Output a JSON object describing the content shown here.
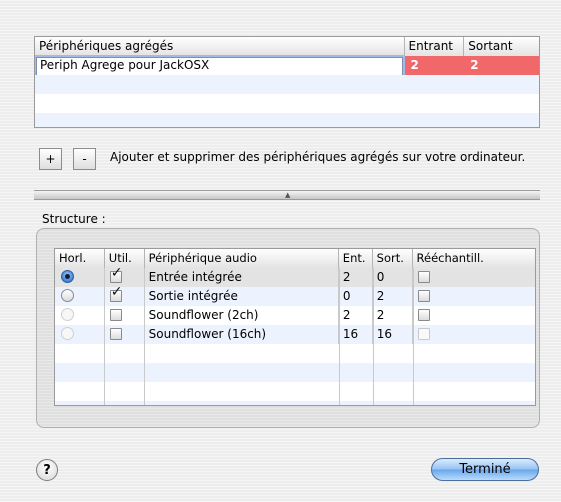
{
  "aggregate_table": {
    "columns": [
      "Périphériques agrégés",
      "Entrant",
      "Sortant"
    ],
    "rows": [
      {
        "name": "Periph Agrege pour JackOSX",
        "inputs": "2",
        "outputs": "2"
      }
    ],
    "selected_color": "#f0686a"
  },
  "buttons": {
    "add": "+",
    "remove": "-",
    "help": "?",
    "done": "Terminé"
  },
  "description": "Ajouter et supprimer des périphériques agrégés sur votre ordinateur.",
  "structure": {
    "label": "Structure :",
    "columns": [
      "Horl.",
      "Util.",
      "Périphérique audio",
      "Ent.",
      "Sort.",
      "Rééchantill."
    ],
    "rows": [
      {
        "clock": "selected",
        "use": true,
        "use_enabled": true,
        "device": "Entrée intégrée",
        "in": "2",
        "out": "0",
        "resample": false
      },
      {
        "clock": "off",
        "use": true,
        "use_enabled": true,
        "device": "Sortie intégrée",
        "in": "0",
        "out": "2",
        "resample": false
      },
      {
        "clock": "disabled",
        "use": false,
        "use_enabled": true,
        "device": "Soundflower (2ch)",
        "in": "2",
        "out": "2",
        "resample": false
      },
      {
        "clock": "disabled",
        "use": false,
        "use_enabled": true,
        "device": "Soundflower (16ch)",
        "in": "16",
        "out": "16",
        "resample": false
      }
    ]
  }
}
